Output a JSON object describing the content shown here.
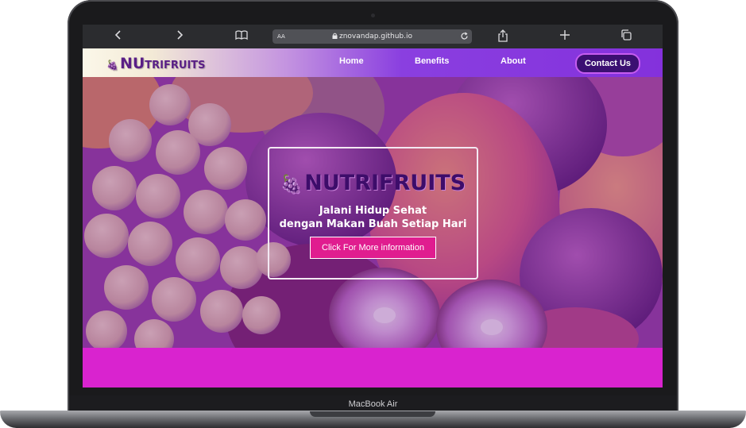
{
  "browser": {
    "aa_label": "AA",
    "url": "znovandap.github.io",
    "icons": [
      "chevron-left-icon",
      "chevron-right-icon",
      "book-icon",
      "lock-icon",
      "reload-icon",
      "share-icon",
      "plus-icon",
      "tabs-icon"
    ]
  },
  "navbar": {
    "logo_nu": "NU",
    "logo_rest": "TRIFRUITS",
    "links": [
      "Home",
      "Benefits",
      "About"
    ],
    "contact_label": "Contact Us"
  },
  "hero": {
    "brand": "NUTRIFRUITS",
    "line1": "Jalani Hidup Sehat",
    "line2": "dengan Makan Buah Setiap Hari",
    "cta_label": "Click For More information"
  },
  "device": {
    "label": "MacBook Air"
  },
  "colors": {
    "accent": "#8431dc",
    "brand_dark": "#3d0d6a",
    "cta": "#e01d8f",
    "band": "#d923cf"
  }
}
